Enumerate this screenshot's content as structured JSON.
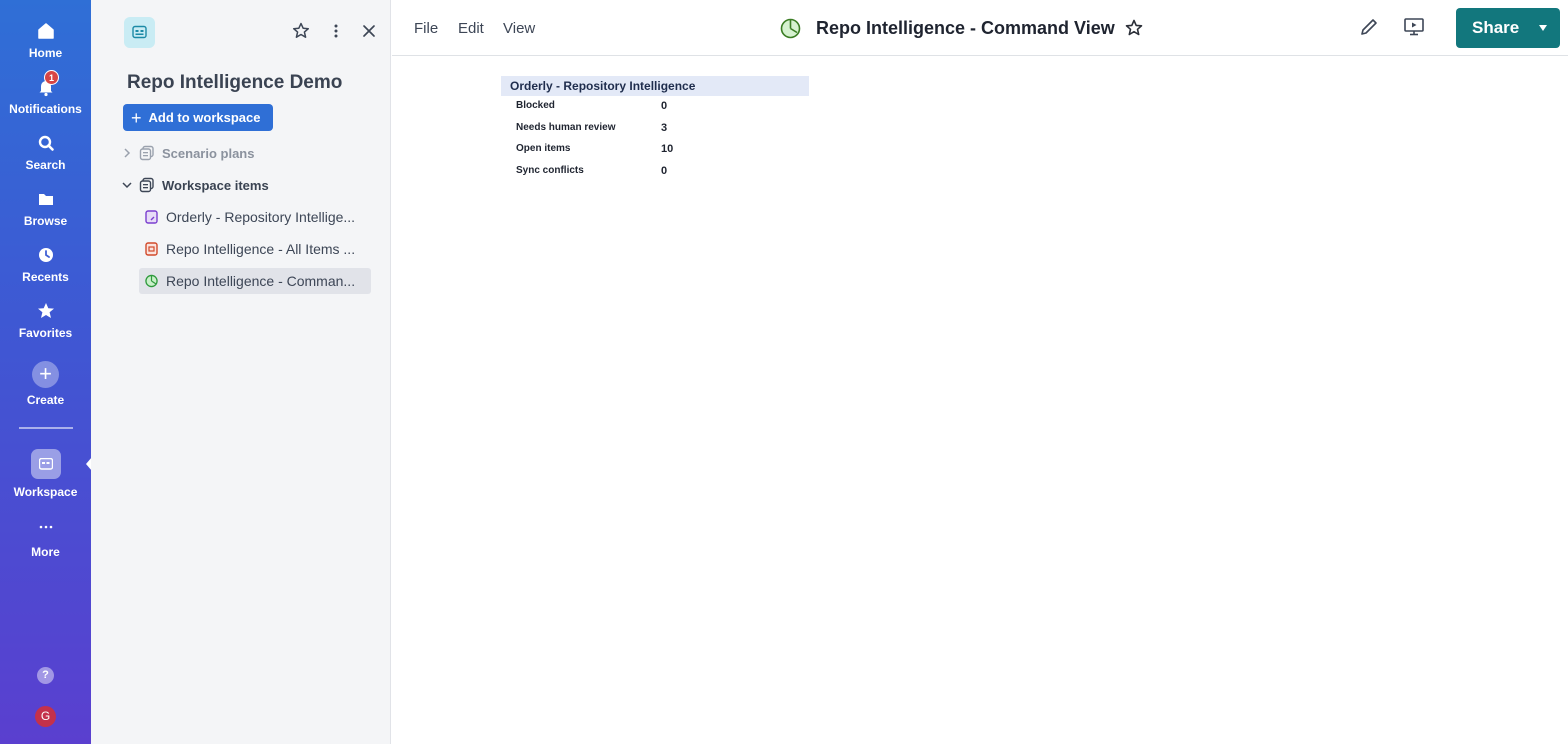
{
  "global_nav": {
    "items": [
      {
        "label": "Home",
        "icon": "home-icon"
      },
      {
        "label": "Notifications",
        "icon": "bell-icon",
        "badge": "1"
      },
      {
        "label": "Search",
        "icon": "search-icon"
      },
      {
        "label": "Browse",
        "icon": "folder-icon"
      },
      {
        "label": "Recents",
        "icon": "clock-icon"
      },
      {
        "label": "Favorites",
        "icon": "star-icon"
      },
      {
        "label": "Create",
        "icon": "plus-icon"
      },
      {
        "label": "Workspace",
        "icon": "workspace-icon"
      },
      {
        "label": "More",
        "icon": "more-dots-icon"
      }
    ],
    "help_glyph": "?",
    "avatar_initial": "G"
  },
  "workspace_panel": {
    "title": "Repo Intelligence Demo",
    "add_button_label": "Add to workspace",
    "tree": {
      "scenario_plans": "Scenario plans",
      "workspace_items": "Workspace items",
      "children": [
        {
          "label": "Orderly - Repository Intellige...",
          "icon": "report-icon"
        },
        {
          "label": "Repo Intelligence - All Items ...",
          "icon": "sheet-icon"
        },
        {
          "label": "Repo Intelligence - Comman...",
          "icon": "dashboard-icon",
          "active": true
        }
      ]
    }
  },
  "topbar": {
    "menus": [
      "File",
      "Edit",
      "View"
    ],
    "document_title": "Repo Intelligence - Command View",
    "share_label": "Share"
  },
  "report": {
    "title": "Orderly - Repository Intelligence",
    "rows": [
      {
        "label": "Blocked",
        "value": "0"
      },
      {
        "label": "Needs human review",
        "value": "3"
      },
      {
        "label": "Open items",
        "value": "10"
      },
      {
        "label": "Sync conflicts",
        "value": "0"
      }
    ]
  },
  "colors": {
    "nav_gradient_top": "#2f6fd6",
    "nav_gradient_bottom": "#5a3fcf",
    "share_button": "#12777d",
    "add_button": "#2f6fd6",
    "notification_badge": "#d64545"
  }
}
